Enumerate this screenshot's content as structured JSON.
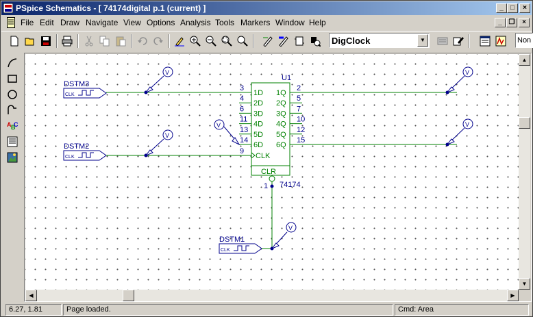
{
  "window": {
    "title": "PSpice Schematics - [ 74174digital  p.1 (current) ]"
  },
  "menu": [
    "File",
    "Edit",
    "Draw",
    "Navigate",
    "View",
    "Options",
    "Analysis",
    "Tools",
    "Markers",
    "Window",
    "Help"
  ],
  "toolbar": {
    "part_combo_value": "DigClock",
    "attr_combo_value": "Non"
  },
  "schematic": {
    "stimuli": [
      {
        "ref": "DSTM3",
        "pin": "CLK"
      },
      {
        "ref": "DSTM2",
        "pin": "CLK"
      },
      {
        "ref": "DSTM1",
        "pin": "CLK"
      }
    ],
    "voltage_marker_label": "V",
    "chip": {
      "ref": "U1",
      "part": "74174",
      "inputs": [
        {
          "pin": "3",
          "name": "1D"
        },
        {
          "pin": "4",
          "name": "2D"
        },
        {
          "pin": "6",
          "name": "3D"
        },
        {
          "pin": "11",
          "name": "4D"
        },
        {
          "pin": "13",
          "name": "5D"
        },
        {
          "pin": "14",
          "name": "6D"
        }
      ],
      "outputs": [
        {
          "pin": "2",
          "name": "1Q"
        },
        {
          "pin": "5",
          "name": "2Q"
        },
        {
          "pin": "7",
          "name": "3Q"
        },
        {
          "pin": "10",
          "name": "4Q"
        },
        {
          "pin": "12",
          "name": "5Q"
        },
        {
          "pin": "15",
          "name": "6Q"
        }
      ],
      "clk": {
        "pin": "9",
        "name": "CLK"
      },
      "clr": {
        "pin": "1",
        "name": "CLR"
      }
    }
  },
  "status": {
    "coords": "6.27, 1.81",
    "message": "Page loaded.",
    "cmd": "Cmd: Area"
  }
}
